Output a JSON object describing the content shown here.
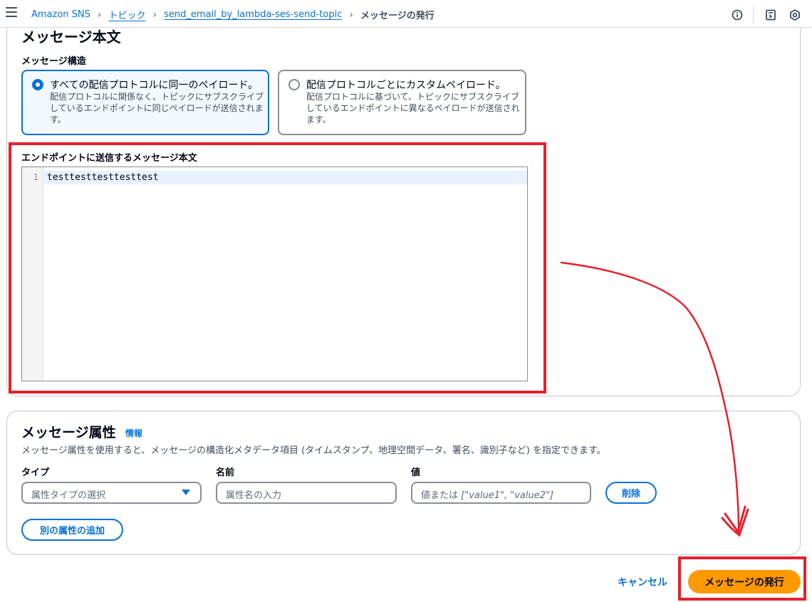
{
  "breadcrumb": {
    "items": [
      "Amazon SNS",
      "トピック",
      "send_email_by_lambda-ses-send-topic"
    ],
    "current": "メッセージの発行"
  },
  "top_icons": [
    "info-icon",
    "notes-icon",
    "settings-hex-icon"
  ],
  "message_body": {
    "title": "メッセージ本文",
    "structure_label": "メッセージ構造",
    "options": [
      {
        "title": "すべての配信プロトコルに同一のペイロード。",
        "description": "配信プロトコルに関係なく、トピックにサブスクライブしているエンドポイントに同じペイロードが送信されます。",
        "selected": true
      },
      {
        "title": "配信プロトコルごとにカスタムペイロード。",
        "description": "配信プロトコルに基づいて、トピックにサブスクライブしているエンドポイントに異なるペイロードが送信されます。",
        "selected": false
      }
    ],
    "editor_label": "エンドポイントに送信するメッセージ本文",
    "editor_line_number": "1",
    "editor_text": "testtesttesttesttest"
  },
  "attributes": {
    "title": "メッセージ属性",
    "info": "情報",
    "description": "メッセージ属性を使用すると、メッセージの構造化メタデータ項目 (タイムスタンプ、地理空間データ、署名、識別子など) を指定できます。",
    "type_label": "タイプ",
    "type_placeholder": "属性タイプの選択",
    "name_label": "名前",
    "name_placeholder": "属性名の入力",
    "value_label": "値",
    "value_placeholder_prefix": "値または ",
    "value_placeholder_example": "[\"value1\", \"value2\"]",
    "delete_label": "削除",
    "add_label": "別の属性の追加"
  },
  "actions": {
    "cancel_label": "キャンセル",
    "publish_label": "メッセージの発行"
  },
  "colors": {
    "link": "#0972d3",
    "primary": "#ff9900",
    "annotation": "#e8202a"
  }
}
